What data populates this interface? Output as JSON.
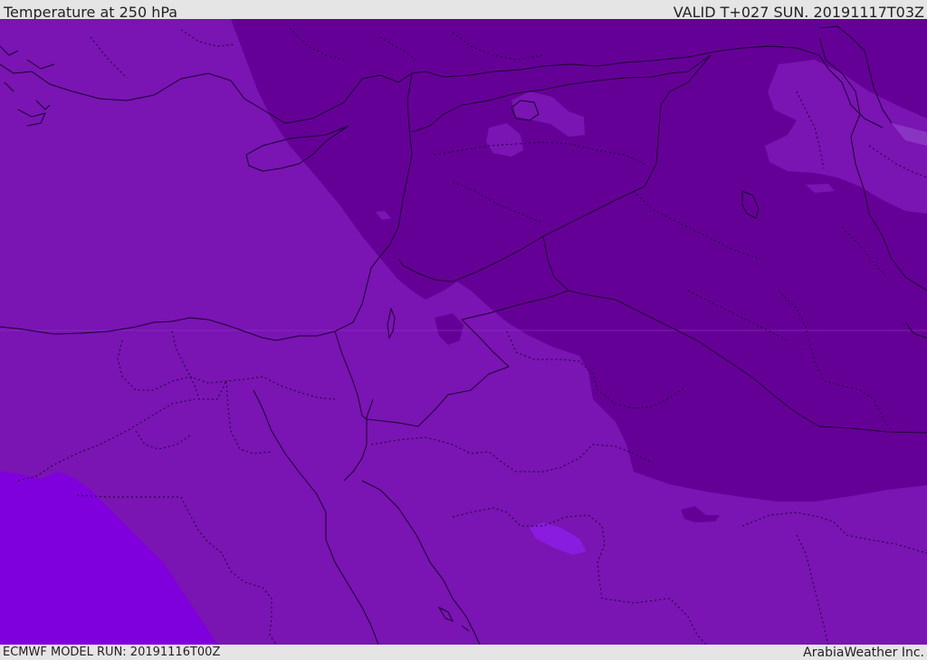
{
  "header": {
    "title": "Temperature at 250 hPa",
    "valid_time": "VALID T+027 SUN. 20191117T03Z"
  },
  "footer": {
    "model_run": "ECMWF MODEL RUN: 20191116T00Z",
    "credit": "ArabiaWeather Inc."
  },
  "map": {
    "field": "Temperature at 250 hPa",
    "colors": {
      "base_band": "#7a14b3",
      "cold_band": "#650097",
      "warm_band": "#7f00dc",
      "light_patch": "#8a35c2",
      "coastline": "#1a0030",
      "border": "#220033"
    },
    "layers": [
      "temperature-shading",
      "coastlines",
      "country-borders",
      "province-borders"
    ]
  }
}
